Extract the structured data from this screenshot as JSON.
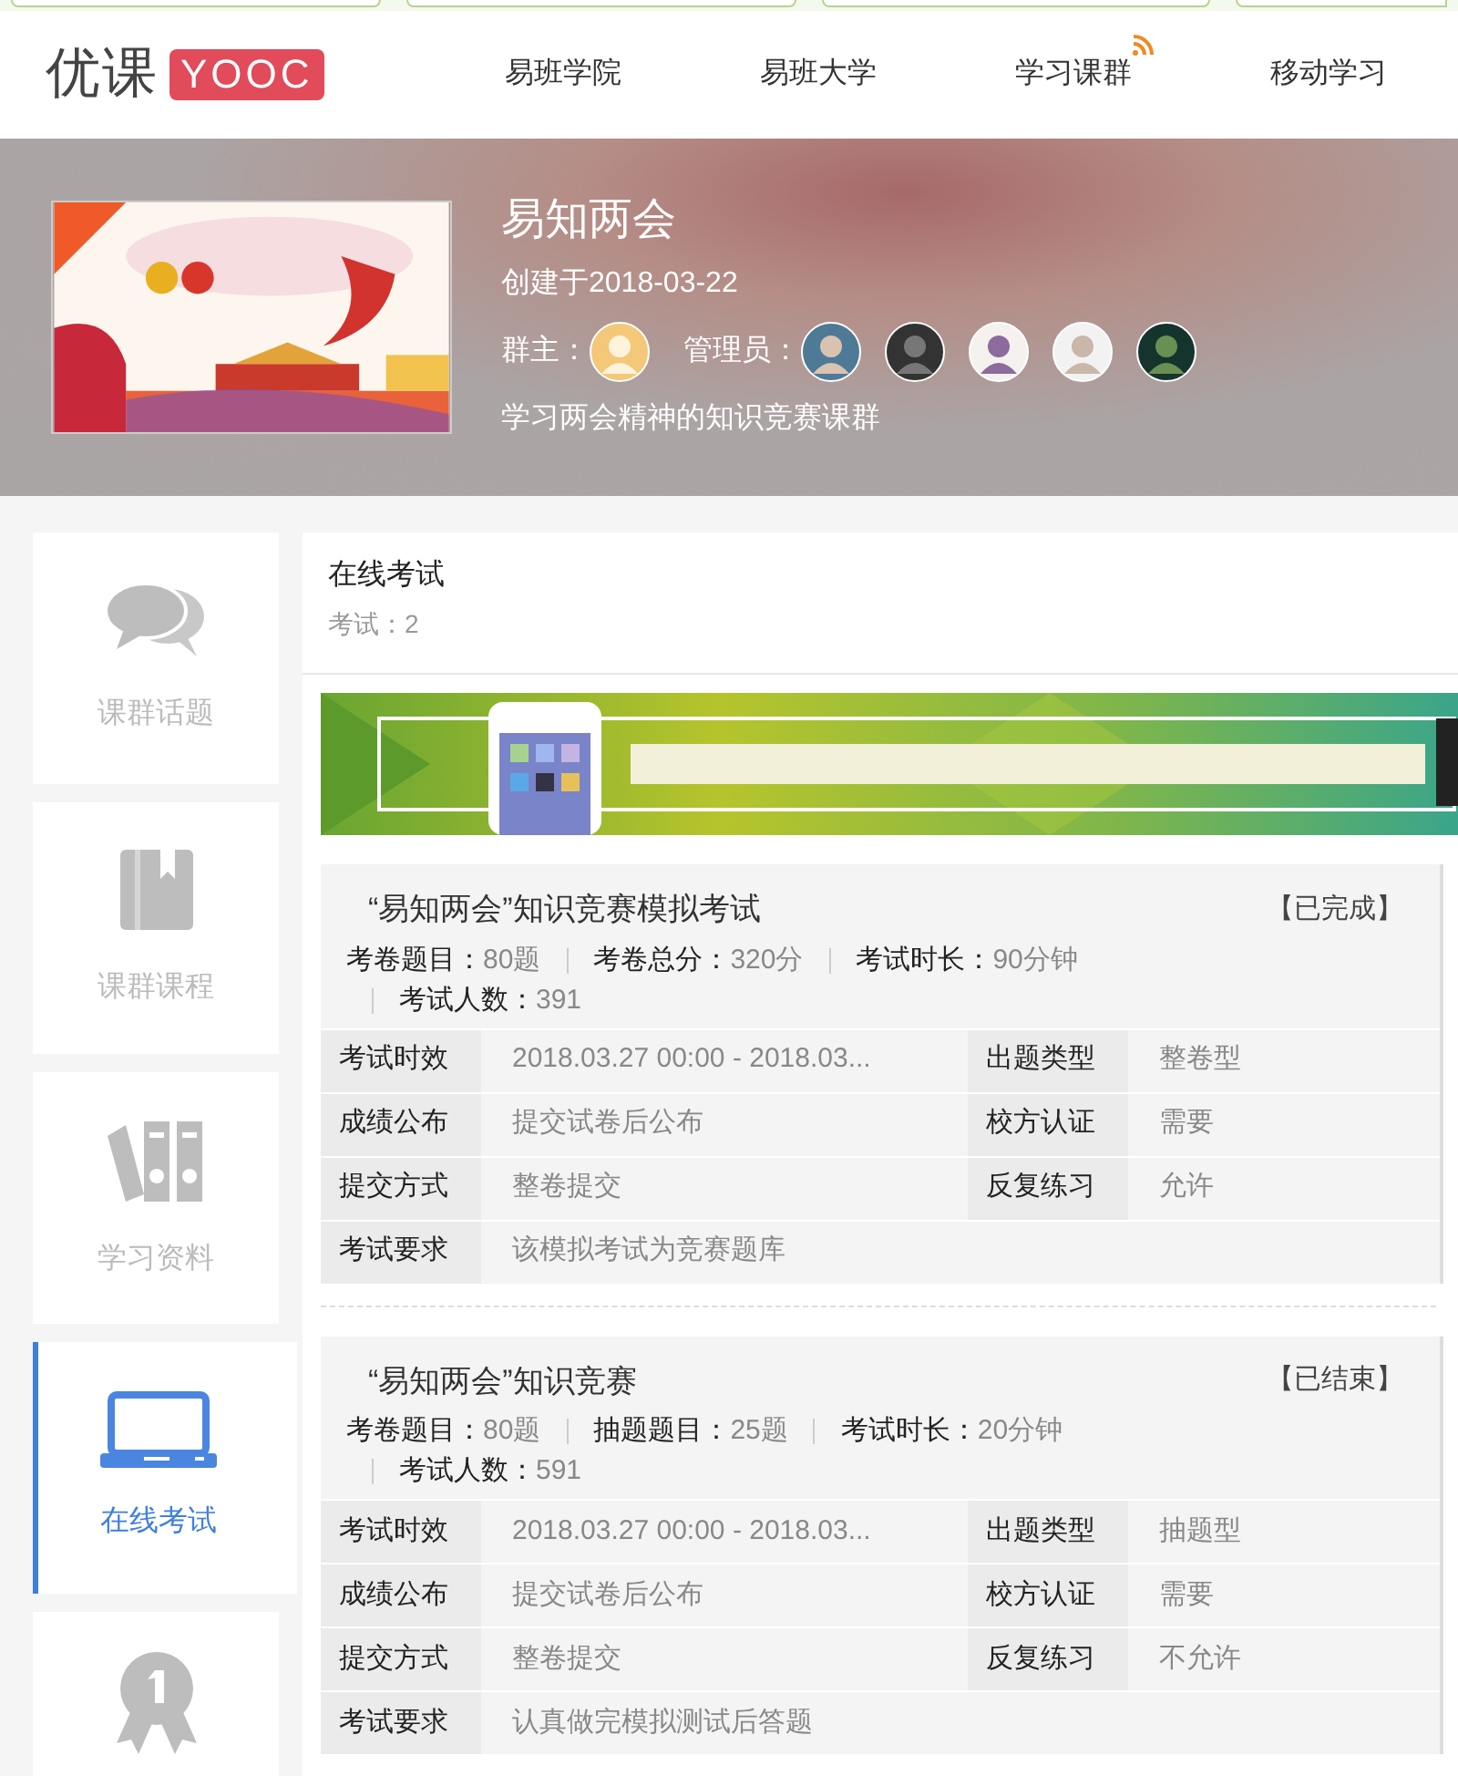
{
  "header": {
    "logo_text": "优课",
    "logo_badge": "YOOC",
    "nav": [
      {
        "label": "易班学院",
        "feed": false
      },
      {
        "label": "易班大学",
        "feed": false
      },
      {
        "label": "学习课群",
        "feed": true
      },
      {
        "label": "移动学习",
        "feed": false
      }
    ]
  },
  "group": {
    "title": "易知两会",
    "created": "创建于2018-03-22",
    "owner_label": "群主：",
    "admin_label": "管理员：",
    "description": "学习两会精神的知识竞赛课群"
  },
  "sidebar": [
    {
      "kind": "chat",
      "label": "课群话题",
      "selected": false
    },
    {
      "kind": "book",
      "label": "课群课程",
      "selected": false
    },
    {
      "kind": "binders",
      "label": "学习资料",
      "selected": false
    },
    {
      "kind": "laptop",
      "label": "在线考试",
      "selected": true
    },
    {
      "kind": "medal",
      "selected": false
    }
  ],
  "section": {
    "title": "在线考试",
    "count": "考试：2"
  },
  "exams": [
    {
      "title": "“易知两会”知识竞赛模拟考试",
      "status": "【已完成】",
      "stats": [
        {
          "label": "考卷题目：",
          "value": "80题"
        },
        {
          "label": "考卷总分：",
          "value": "320分"
        },
        {
          "label": "考试时长：",
          "value": "90分钟"
        },
        {
          "label": "考试人数：",
          "value": "391"
        }
      ],
      "rows": [
        [
          {
            "label": "考试时效",
            "value": "2018.03.27 00:00 - 2018.03..."
          },
          {
            "label": "出题类型",
            "value": "整卷型"
          }
        ],
        [
          {
            "label": "成绩公布",
            "value": "提交试卷后公布"
          },
          {
            "label": "校方认证",
            "value": "需要"
          }
        ],
        [
          {
            "label": "提交方式",
            "value": "整卷提交"
          },
          {
            "label": "反复练习",
            "value": "允许"
          }
        ],
        [
          {
            "label": "考试要求",
            "value": "该模拟考试为竞赛题库"
          }
        ]
      ]
    },
    {
      "title": "“易知两会”知识竞赛",
      "status": "【已结束】",
      "stats": [
        {
          "label": "考卷题目：",
          "value": "80题"
        },
        {
          "label": "抽题题目：",
          "value": "25题"
        },
        {
          "label": "考试时长：",
          "value": "20分钟"
        },
        {
          "label": "考试人数：",
          "value": "591"
        }
      ],
      "rows": [
        [
          {
            "label": "考试时效",
            "value": "2018.03.27 00:00 - 2018.03..."
          },
          {
            "label": "出题类型",
            "value": "抽题型"
          }
        ],
        [
          {
            "label": "成绩公布",
            "value": "提交试卷后公布"
          },
          {
            "label": "校方认证",
            "value": "需要"
          }
        ],
        [
          {
            "label": "提交方式",
            "value": "整卷提交"
          },
          {
            "label": "反复练习",
            "value": "不允许"
          }
        ],
        [
          {
            "label": "考试要求",
            "value": "认真做完模拟测试后答题"
          }
        ]
      ]
    }
  ]
}
